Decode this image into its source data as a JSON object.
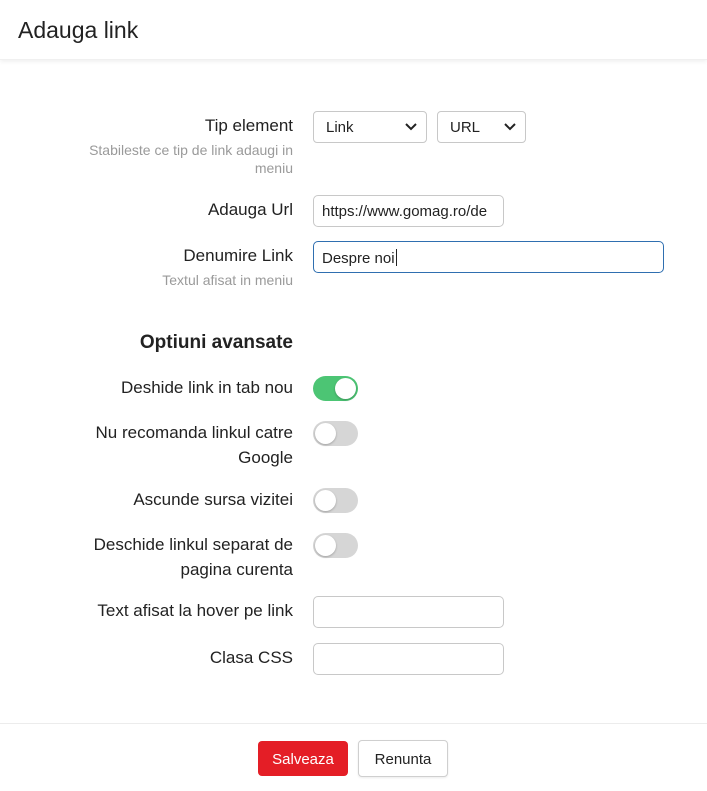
{
  "dialog": {
    "title": "Adauga link"
  },
  "form": {
    "tip_element": {
      "label": "Tip element",
      "hint": "Stabileste ce tip de link adaugi in meniu",
      "type_select": "Link",
      "source_select": "URL"
    },
    "url": {
      "label": "Adauga Url",
      "value": "https://www.gomag.ro/de"
    },
    "denumire": {
      "label": "Denumire Link",
      "hint": "Textul afisat in meniu",
      "value": "Despre noi"
    }
  },
  "advanced": {
    "title": "Optiuni avansate",
    "new_tab": {
      "label": "Deshide link in tab nou",
      "enabled": true
    },
    "nofollow": {
      "label_line1": "Nu recomanda linkul catre",
      "label_line2": "Google",
      "enabled": false
    },
    "hide_referrer": {
      "label": "Ascunde sursa vizitei",
      "enabled": false
    },
    "separate_page": {
      "label_line1": "Deschide linkul separat de",
      "label_line2": "pagina curenta",
      "enabled": false
    },
    "hover_text": {
      "label": "Text afisat la hover pe link",
      "value": ""
    },
    "css_class": {
      "label": "Clasa CSS",
      "value": ""
    }
  },
  "footer": {
    "save_label": "Salveaza",
    "cancel_label": "Renunta"
  },
  "colors": {
    "accent_red": "#e41e26",
    "toggle_on": "#4cc574",
    "focus_border": "#2f6fb0"
  }
}
